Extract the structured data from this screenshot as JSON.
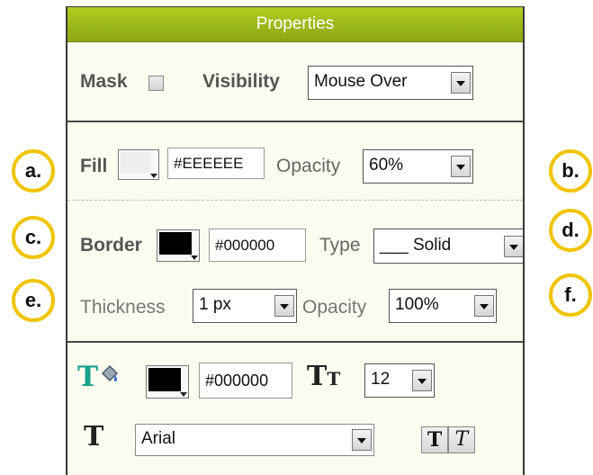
{
  "header": {
    "title": "Properties"
  },
  "mask": {
    "label": "Mask",
    "checked": false
  },
  "visibility": {
    "label": "Visibility",
    "selected": "Mouse Over"
  },
  "fill": {
    "label": "Fill",
    "color_hex": "#EEEEEE",
    "swatch_color": "#eeeeee",
    "opacity_label": "Opacity",
    "opacity": "60%"
  },
  "border": {
    "label": "Border",
    "color_hex": "#000000",
    "swatch_color": "#000000",
    "type_label": "Type",
    "type_value": "Solid",
    "type_line": "___"
  },
  "thickness": {
    "label": "Thickness",
    "value": "1 px",
    "opacity_label": "Opacity",
    "opacity": "100%"
  },
  "text": {
    "color_hex": "#000000",
    "swatch_color": "#000000",
    "size_glyph": "T",
    "size_glyph_small": "T",
    "font_size": "12",
    "font_glyph": "T",
    "font_family": "Arial",
    "bold_label": "T",
    "italic_label": "T"
  },
  "callouts": {
    "a": "a.",
    "b": "b.",
    "c": "c.",
    "d": "d.",
    "e": "e.",
    "f": "f."
  },
  "colors": {
    "header_green": "#9bb81a",
    "callout_ring": "#f0c400",
    "panel_bg": "#fbfbf0"
  }
}
